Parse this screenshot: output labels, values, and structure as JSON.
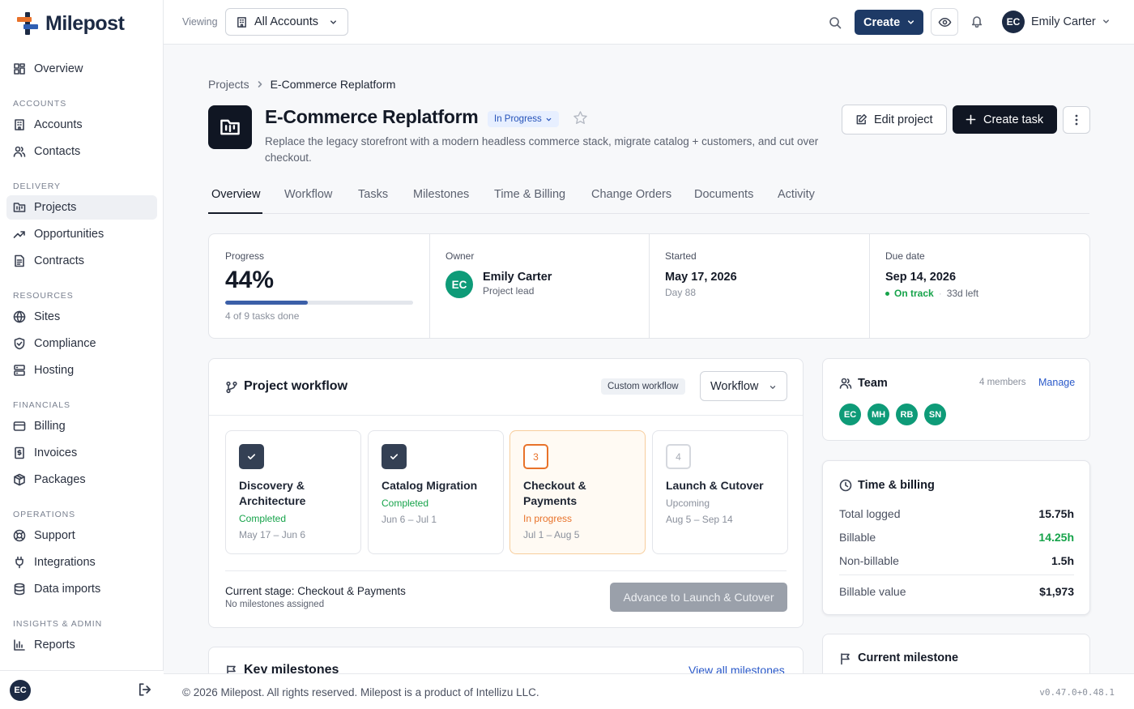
{
  "brand": {
    "name": "Milepost",
    "colors": {
      "primary": "#1e3a66",
      "accent": "#e8722a",
      "success": "#16a34a",
      "avatar": "#0e9b78"
    }
  },
  "sidebar": {
    "overview": "Overview",
    "sections": [
      {
        "label": "ACCOUNTS",
        "items": [
          "Accounts",
          "Contacts"
        ]
      },
      {
        "label": "DELIVERY",
        "items": [
          "Projects",
          "Opportunities",
          "Contracts"
        ]
      },
      {
        "label": "RESOURCES",
        "items": [
          "Sites",
          "Compliance",
          "Hosting"
        ]
      },
      {
        "label": "FINANCIALS",
        "items": [
          "Billing",
          "Invoices",
          "Packages"
        ]
      },
      {
        "label": "OPERATIONS",
        "items": [
          "Support",
          "Integrations",
          "Data imports"
        ]
      },
      {
        "label": "INSIGHTS & ADMIN",
        "items": [
          "Reports"
        ]
      }
    ],
    "active": "Projects",
    "user_initials": "EC"
  },
  "topbar": {
    "viewing_label": "Viewing",
    "account_select": "All Accounts",
    "create_label": "Create",
    "user_initials": "EC",
    "user_name": "Emily Carter"
  },
  "breadcrumb": {
    "parent": "Projects",
    "current": "E-Commerce Replatform"
  },
  "project": {
    "title": "E-Commerce Replatform",
    "status": "In Progress",
    "description": "Replace the legacy storefront with a modern headless commerce stack, migrate catalog + customers, and cut over checkout.",
    "edit_label": "Edit project",
    "create_task_label": "Create task"
  },
  "tabs": [
    "Overview",
    "Workflow",
    "Tasks",
    "Milestones",
    "Time & Billing",
    "Change Orders",
    "Documents",
    "Activity"
  ],
  "stats": {
    "progress": {
      "label": "Progress",
      "value": "44%",
      "fraction": 0.44,
      "sub": "4 of 9 tasks done"
    },
    "owner": {
      "label": "Owner",
      "initials": "EC",
      "name": "Emily Carter",
      "role": "Project lead"
    },
    "started": {
      "label": "Started",
      "date": "May 17, 2026",
      "sub": "Day 88"
    },
    "due": {
      "label": "Due date",
      "date": "Sep 14, 2026",
      "status": "On track",
      "left": "33d left"
    }
  },
  "workflow": {
    "title": "Project workflow",
    "badge": "Custom workflow",
    "select": "Workflow",
    "stages": [
      {
        "name": "Discovery & Architecture",
        "status": "Completed",
        "dates": "May 17 – Jun 6",
        "state": "done"
      },
      {
        "name": "Catalog Migration",
        "status": "Completed",
        "dates": "Jun 6 – Jul 1",
        "state": "done"
      },
      {
        "num": "3",
        "name": "Checkout & Payments",
        "status": "In progress",
        "dates": "Jul 1 – Aug 5",
        "state": "current"
      },
      {
        "num": "4",
        "name": "Launch & Cutover",
        "status": "Upcoming",
        "dates": "Aug 5 – Sep 14",
        "state": "upcoming"
      }
    ],
    "current_stage": "Current stage: Checkout & Payments",
    "milestones_note": "No milestones assigned",
    "advance_label": "Advance to Launch & Cutover"
  },
  "milestones": {
    "title": "Key milestones",
    "link": "View all milestones"
  },
  "team": {
    "title": "Team",
    "count": "4 members",
    "manage": "Manage",
    "members": [
      "EC",
      "MH",
      "RB",
      "SN"
    ]
  },
  "time_billing": {
    "title": "Time & billing",
    "rows": [
      {
        "label": "Total logged",
        "value": "15.75h"
      },
      {
        "label": "Billable",
        "value": "14.25h"
      },
      {
        "label": "Non-billable",
        "value": "1.5h"
      }
    ],
    "value_label": "Billable value",
    "value": "$1,973"
  },
  "current_milestone": {
    "title": "Current milestone"
  },
  "footer": {
    "text": "© 2026 Milepost. All rights reserved. Milepost is a product of Intellizu LLC.",
    "version": "v0.47.0+0.48.1"
  }
}
